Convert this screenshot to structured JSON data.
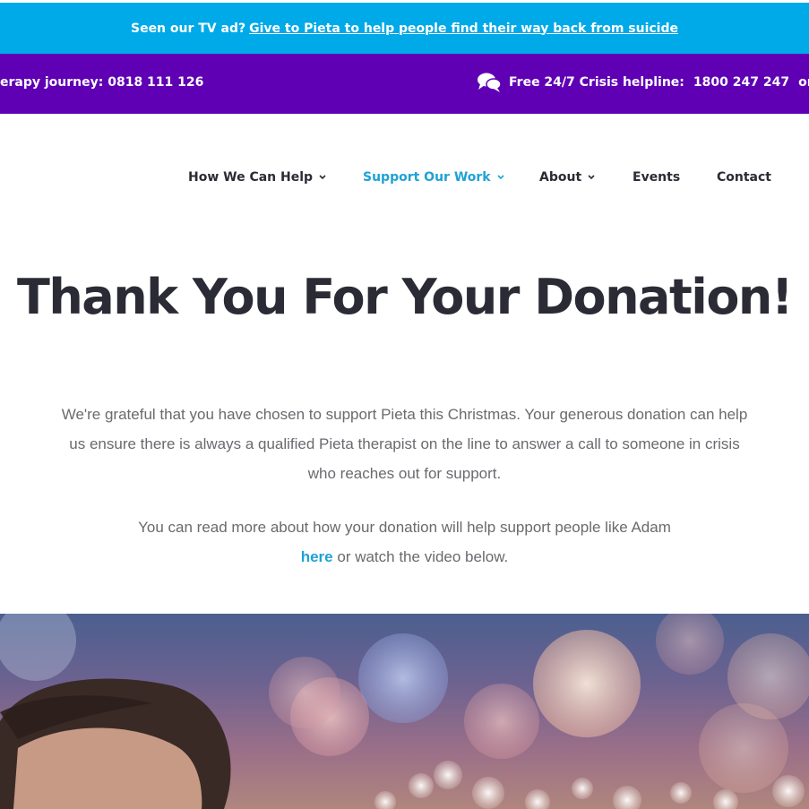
{
  "promo": {
    "lead": "Seen our TV ad?",
    "link": "Give to Pieta to help people find their way back from suicide"
  },
  "helpline": {
    "left_text": "erapy journey: 0818 111 126",
    "label": "Free 24/7 Crisis helpline:",
    "number": "1800 247 247",
    "or": "or",
    "icon": "chat-bubbles-icon"
  },
  "nav": {
    "items": [
      {
        "label": "How We Can Help",
        "has_dropdown": true
      },
      {
        "label": "Support Our Work",
        "has_dropdown": true,
        "active": true
      },
      {
        "label": "About",
        "has_dropdown": true
      },
      {
        "label": "Events",
        "has_dropdown": false
      },
      {
        "label": "Contact",
        "has_dropdown": false
      }
    ]
  },
  "main": {
    "title": "Thank You For Your Donation!",
    "para1": "We're grateful that you have chosen to support Pieta this Christmas.  Your generous donation can help us ensure there is always a qualified Pieta therapist on the line to answer a call to someone in crisis who reaches out for support.",
    "para2_lead": "You can read more about how your donation will help support people like Adam",
    "para2_link": "here",
    "para2_tail": " or watch the video below."
  },
  "colors": {
    "promo_bg": "#00a9e8",
    "helpline_bg": "#5f00b5",
    "accent": "#1fa2d6",
    "heading": "#2b2b35",
    "body_text": "#6a6a6f"
  }
}
